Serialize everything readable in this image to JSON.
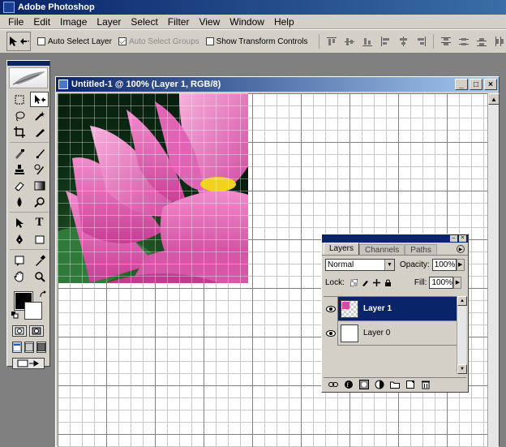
{
  "app": {
    "title": "Adobe Photoshop"
  },
  "menu": [
    "File",
    "Edit",
    "Image",
    "Layer",
    "Select",
    "Filter",
    "View",
    "Window",
    "Help"
  ],
  "options": {
    "auto_select_layer": "Auto Select Layer",
    "auto_select_groups": "Auto Select Groups",
    "show_transform_controls": "Show Transform Controls"
  },
  "document": {
    "title": "Untitled-1 @ 100% (Layer 1, RGB/8)"
  },
  "layers_palette": {
    "tabs": [
      "Layers",
      "Channels",
      "Paths"
    ],
    "blend_mode": "Normal",
    "opacity_label": "Opacity:",
    "opacity_value": "100%",
    "lock_label": "Lock:",
    "fill_label": "Fill:",
    "fill_value": "100%",
    "layers": [
      {
        "name": "Layer 1",
        "selected": true
      },
      {
        "name": "Layer 0",
        "selected": false
      }
    ]
  },
  "colors": {
    "titlebar_start": "#0a246a",
    "foreground": "#000000",
    "background": "#ffffff",
    "lotus_pink": "#e05ab0"
  }
}
